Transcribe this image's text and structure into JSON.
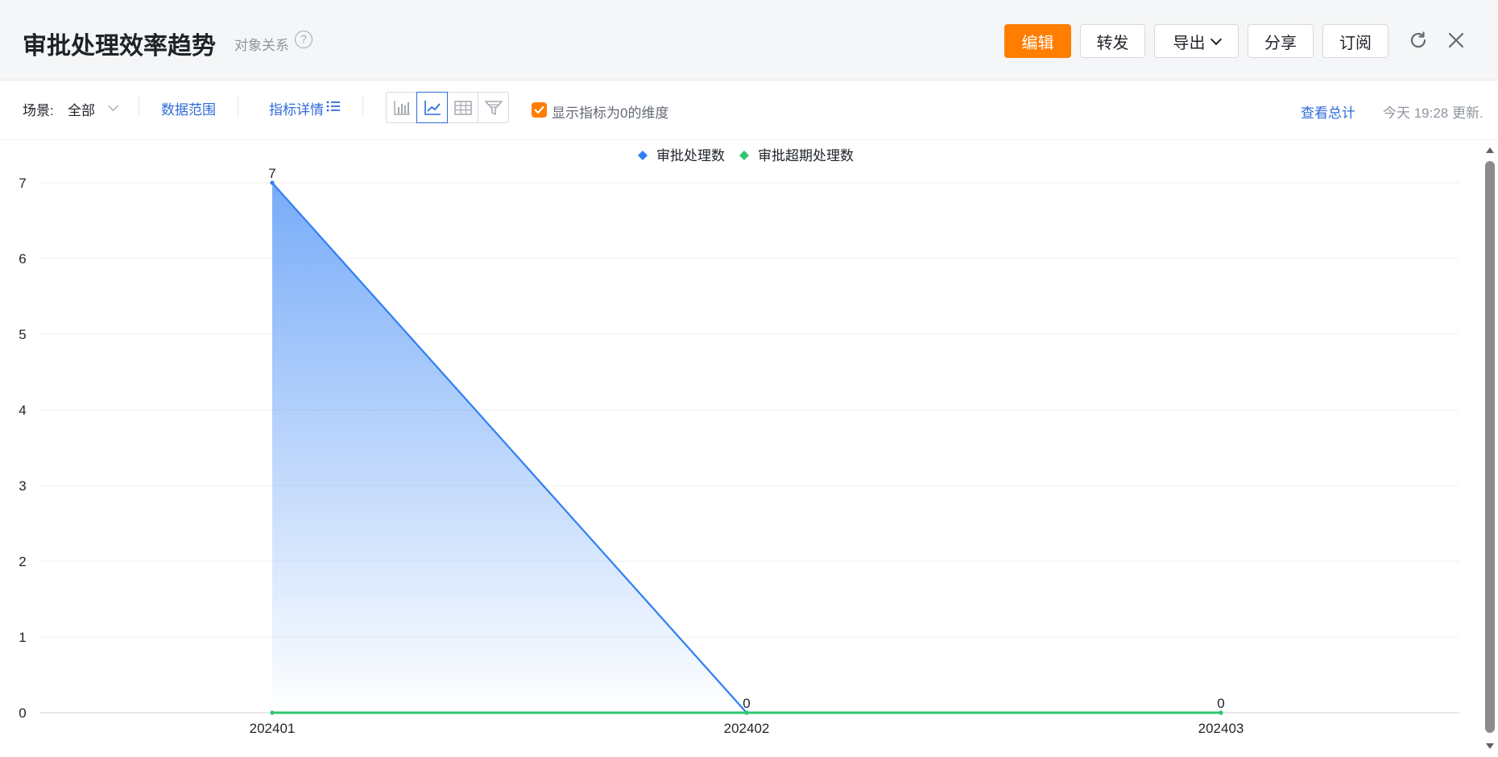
{
  "header": {
    "title": "审批处理效率趋势",
    "subtitle": "对象关系",
    "help_icon": "?",
    "buttons": {
      "edit": "编辑",
      "forward": "转发",
      "export": "导出",
      "share": "分享",
      "subscribe": "订阅"
    },
    "accent_color": "#ff7d00"
  },
  "toolbar": {
    "scene_label": "场景:",
    "scene_value": "全部",
    "data_range": "数据范围",
    "metric_details": "指标详情",
    "show_zero_label": "显示指标为0的维度",
    "show_zero_checked": true,
    "view_total": "查看总计",
    "updated_text": "今天 19:28 更新.",
    "chart_types": [
      "bar-chart-icon",
      "line-chart-icon",
      "table-icon",
      "funnel-icon"
    ],
    "active_chart_type": "line-chart-icon",
    "link_color": "#2f6bd8"
  },
  "chart_data": {
    "type": "line",
    "categories": [
      "202401",
      "202402",
      "202403"
    ],
    "series": [
      {
        "name": "审批处理数",
        "values": [
          7,
          0,
          0
        ],
        "color": "#2f7ff5",
        "area": true
      },
      {
        "name": "审批超期处理数",
        "values": [
          0,
          0,
          0
        ],
        "color": "#2ec86f",
        "area": false
      }
    ],
    "y_ticks": [
      "0",
      "1",
      "2",
      "3",
      "4",
      "5",
      "6",
      "7"
    ],
    "ylim": [
      0,
      7
    ],
    "grid": true,
    "legend_position": "top-center",
    "data_labels": true
  }
}
